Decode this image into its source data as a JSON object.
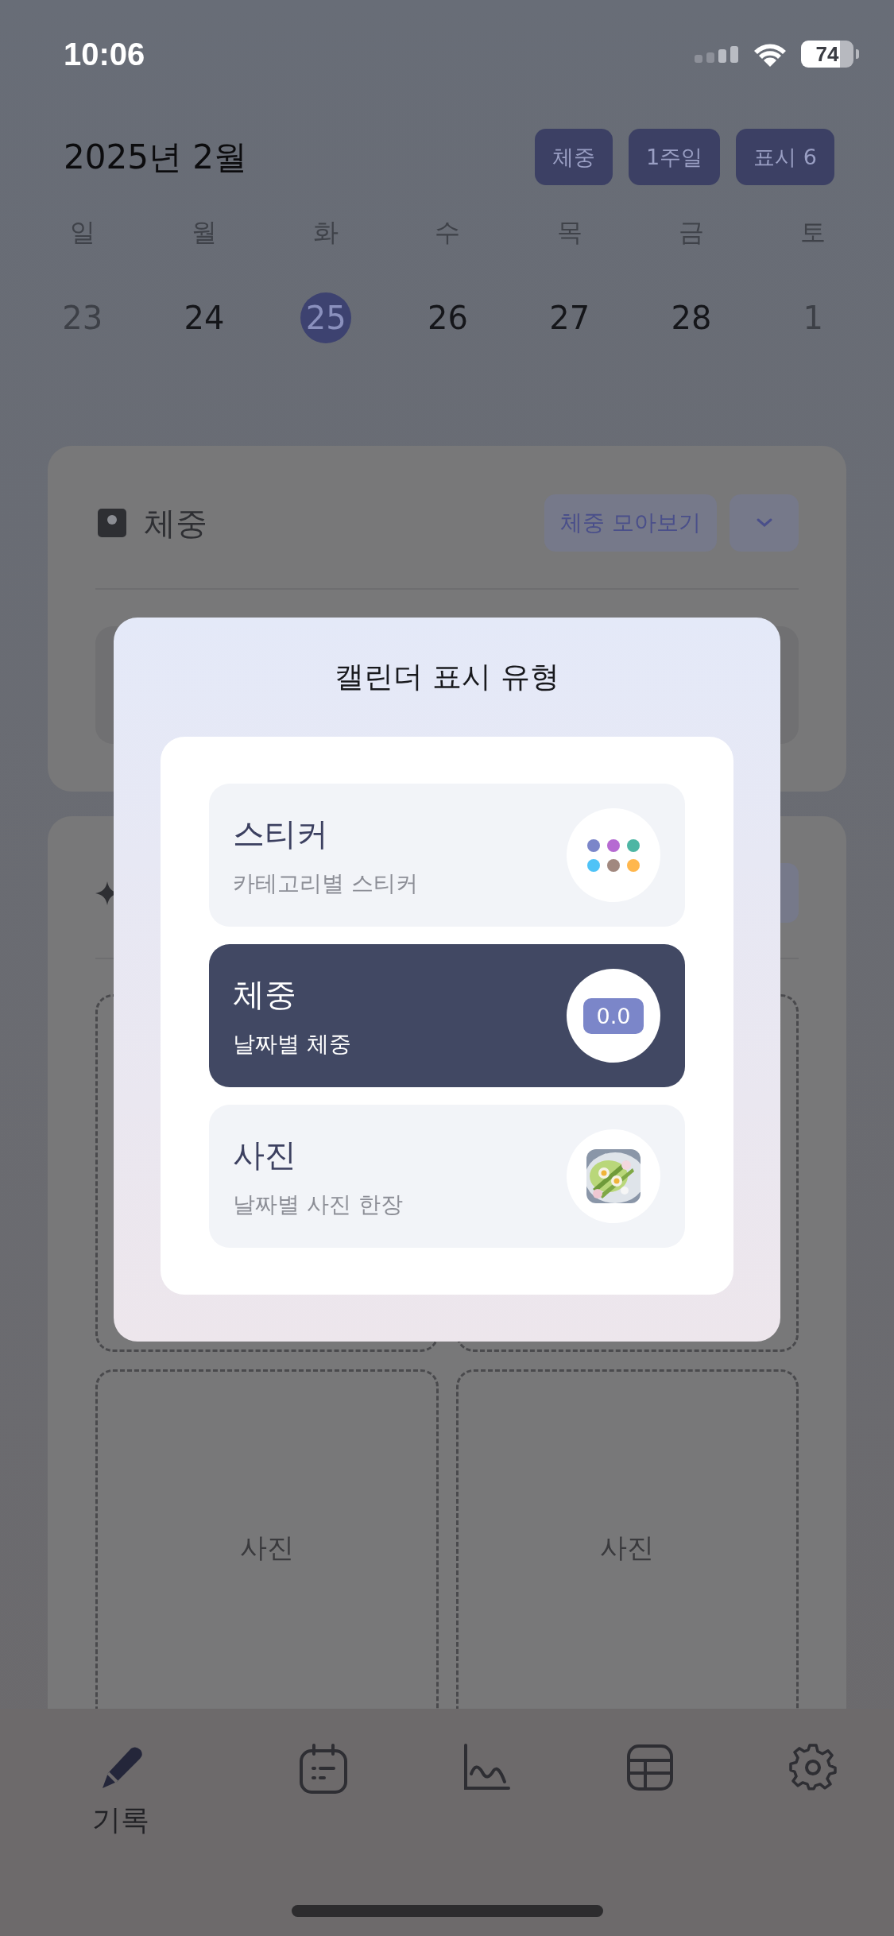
{
  "status_bar": {
    "time": "10:06",
    "battery": "74"
  },
  "header": {
    "month": "2025년 2월",
    "chips": [
      {
        "label": "체중"
      },
      {
        "label": "1주일"
      },
      {
        "label": "표시 6"
      }
    ]
  },
  "weekdays": [
    "일",
    "월",
    "화",
    "수",
    "목",
    "금",
    "토"
  ],
  "dates": [
    {
      "label": "23",
      "selected": false,
      "muted": true
    },
    {
      "label": "24",
      "selected": false,
      "muted": false
    },
    {
      "label": "25",
      "selected": true,
      "muted": false
    },
    {
      "label": "26",
      "selected": false,
      "muted": false
    },
    {
      "label": "27",
      "selected": false,
      "muted": false
    },
    {
      "label": "28",
      "selected": false,
      "muted": false
    },
    {
      "label": "1",
      "selected": false,
      "muted": true
    }
  ],
  "weight_card": {
    "title": "체중",
    "button": "체중 모아보기"
  },
  "photo_card": {
    "slots": [
      {
        "label": "사진"
      },
      {
        "label": "사진"
      }
    ]
  },
  "modal": {
    "title": "캘린더 표시 유형",
    "options": [
      {
        "kind": "sticker",
        "title": "스티커",
        "subtitle": "카테고리별 스티커",
        "selected": false,
        "dots": [
          {
            "color": "#7b86c9"
          },
          {
            "color": "#b66ad2"
          },
          {
            "color": "#4db6a4"
          },
          {
            "color": "#4fc3f7"
          },
          {
            "color": "#a1887f"
          },
          {
            "color": "#ffb74d"
          }
        ]
      },
      {
        "kind": "weight",
        "title": "체중",
        "subtitle": "날짜별 체중",
        "selected": true,
        "value": "0.0"
      },
      {
        "title": "사진",
        "subtitle": "날짜별 사진 한장",
        "selected": false
      }
    ]
  },
  "tab_bar": {
    "tabs": [
      {
        "kind": "pencil",
        "label": "기록",
        "selected": true
      },
      {
        "kind": "calendar",
        "selected": false
      },
      {
        "kind": "chart",
        "selected": false
      },
      {
        "kind": "table",
        "selected": false
      },
      {
        "kind": "settings",
        "selected": false
      }
    ]
  }
}
